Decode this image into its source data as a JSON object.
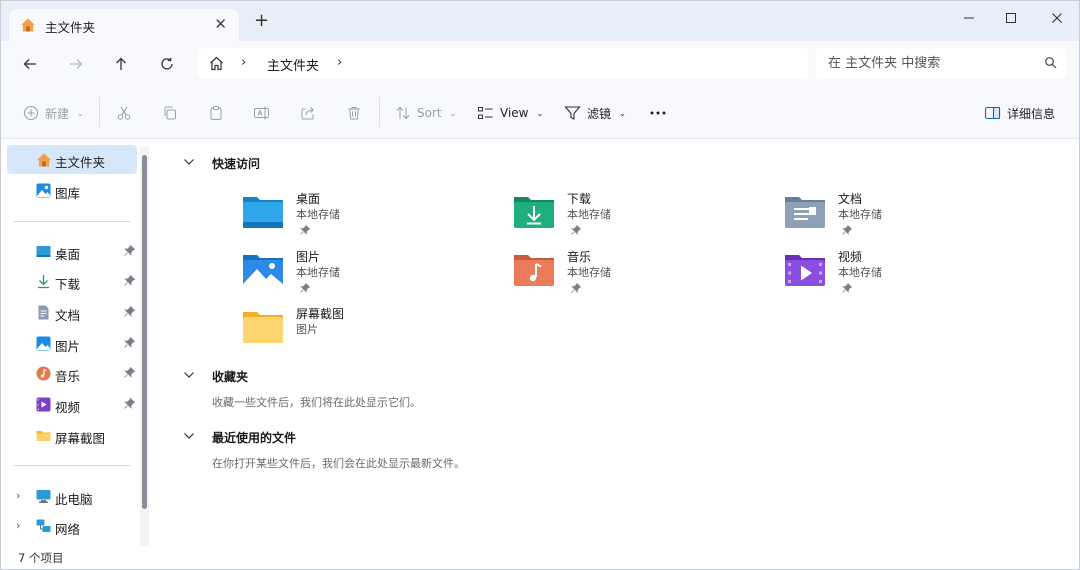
{
  "window": {
    "tab_title": "主文件夹",
    "new_tab_label": "+",
    "close_tab_label": "✕"
  },
  "address_bar": {
    "breadcrumb": "主文件夹",
    "search_placeholder": "在 主文件夹 中搜索"
  },
  "command_bar": {
    "new_label": "新建",
    "sort_label": "Sort",
    "view_label": "View",
    "filter_label": "滤镜",
    "details_label": "详细信息"
  },
  "sidebar": {
    "home": "主文件夹",
    "gallery": "图库",
    "pinned": [
      {
        "label": "桌面",
        "icon": "desktop-icon",
        "pinned": true
      },
      {
        "label": "下载",
        "icon": "download-icon",
        "pinned": true
      },
      {
        "label": "文档",
        "icon": "document-icon",
        "pinned": true
      },
      {
        "label": "图片",
        "icon": "picture-icon",
        "pinned": true
      },
      {
        "label": "音乐",
        "icon": "music-icon",
        "pinned": true
      },
      {
        "label": "视频",
        "icon": "video-icon",
        "pinned": true
      },
      {
        "label": "屏幕截图",
        "icon": "folder-icon",
        "pinned": false
      }
    ],
    "this_pc": "此电脑",
    "network": "网络"
  },
  "main": {
    "quick_access": {
      "title": "快速访问",
      "items": [
        {
          "name": "桌面",
          "sub": "本地存储",
          "icon": "desktop-folder-icon",
          "pinned": true
        },
        {
          "name": "下载",
          "sub": "本地存储",
          "icon": "downloads-folder-icon",
          "pinned": true
        },
        {
          "name": "文档",
          "sub": "本地存储",
          "icon": "documents-folder-icon",
          "pinned": true
        },
        {
          "name": "图片",
          "sub": "本地存储",
          "icon": "pictures-folder-icon",
          "pinned": true
        },
        {
          "name": "音乐",
          "sub": "本地存储",
          "icon": "music-folder-icon",
          "pinned": true
        },
        {
          "name": "视频",
          "sub": "本地存储",
          "icon": "videos-folder-icon",
          "pinned": true
        },
        {
          "name": "屏幕截图",
          "sub": "图片",
          "icon": "screenshots-folder-icon",
          "pinned": false
        }
      ]
    },
    "favorites": {
      "title": "收藏夹",
      "desc": "收藏一些文件后，我们将在此处显示它们。"
    },
    "recent": {
      "title": "最近使用的文件",
      "desc": "在你打开某些文件后，我们会在此处显示最新文件。"
    }
  },
  "status_bar": {
    "item_count": "7 个项目"
  },
  "colors": {
    "accent": "#0067c0",
    "titlebar": "#e7eef8",
    "toolbar": "#f7f9fc",
    "selected": "#d7e7fa"
  }
}
